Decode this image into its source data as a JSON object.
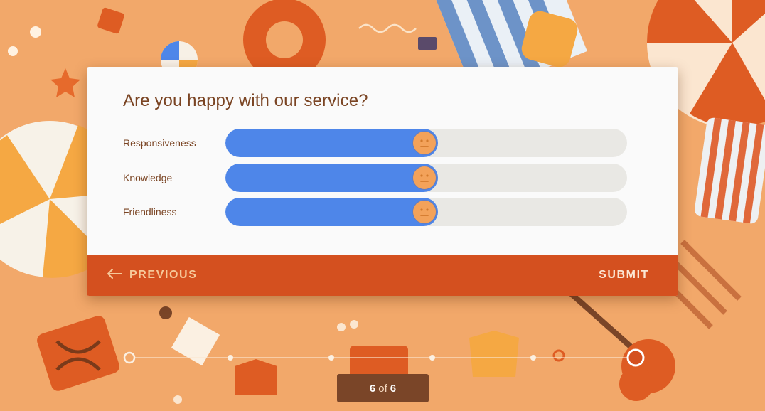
{
  "survey": {
    "question": "Are you happy with our service?",
    "rows": [
      {
        "label": "Responsiveness",
        "value": 0.53
      },
      {
        "label": "Knowledge",
        "value": 0.53
      },
      {
        "label": "Friendliness",
        "value": 0.53
      }
    ]
  },
  "footer": {
    "previous_label": "PREVIOUS",
    "submit_label": "SUBMIT"
  },
  "pager": {
    "current": "6",
    "separator": "of",
    "total": "6"
  },
  "colors": {
    "accent": "#d4501f",
    "slider_fill": "#4e86e9",
    "slider_track": "#e9e8e4",
    "text": "#7a4423"
  },
  "icons": [
    "arrow-left-icon",
    "neutral-face-icon"
  ]
}
